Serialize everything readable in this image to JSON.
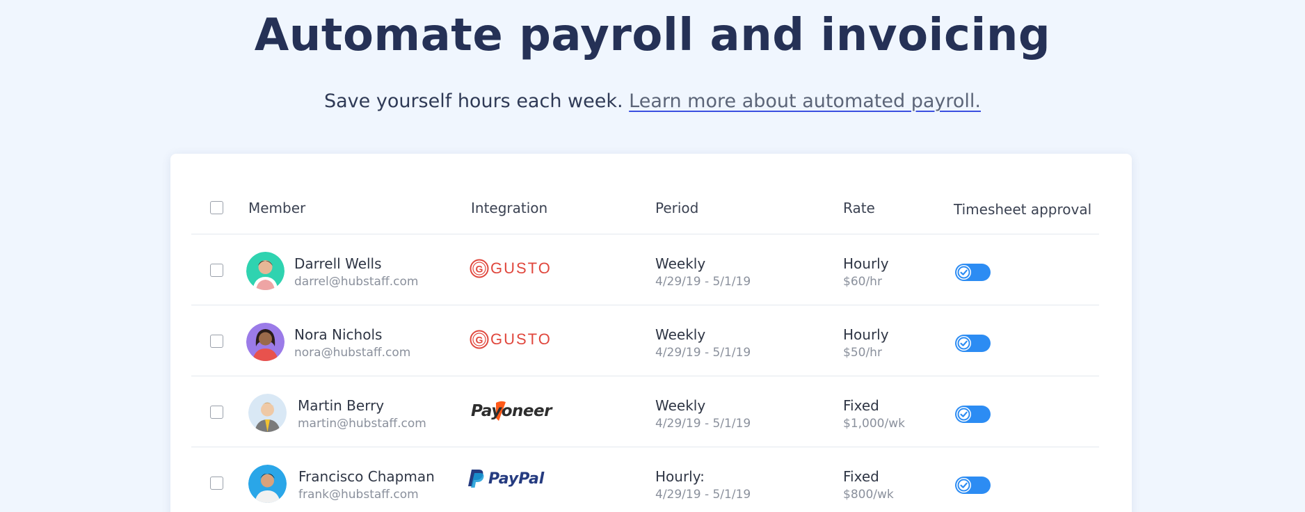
{
  "hero": {
    "title": "Automate payroll and invoicing",
    "subtitle": "Save yourself hours each week.",
    "link": "Learn more about automated payroll."
  },
  "table": {
    "headers": {
      "member": "Member",
      "integration": "Integration",
      "period": "Period",
      "rate": "Rate",
      "timesheet": "Timesheet approval"
    },
    "rows": [
      {
        "name": "Darrell Wells",
        "email": "darrel@hubstaff.com",
        "integration": "GUSTO",
        "period": "Weekly",
        "period_range": "4/29/19 - 5/1/19",
        "rate": "Hourly",
        "rate_value": "$60/hr",
        "avatar_color": "#2fd3b0",
        "timesheet_approved": true
      },
      {
        "name": "Nora Nichols",
        "email": "nora@hubstaff.com",
        "integration": "GUSTO",
        "period": "Weekly",
        "period_range": "4/29/19 - 5/1/19",
        "rate": "Hourly",
        "rate_value": "$50/hr",
        "avatar_color": "#9b7be8",
        "timesheet_approved": true
      },
      {
        "name": "Martin Berry",
        "email": "martin@hubstaff.com",
        "integration": "Payoneer",
        "period": "Weekly",
        "period_range": "4/29/19 - 5/1/19",
        "rate": "Fixed",
        "rate_value": "$1,000/wk",
        "avatar_color": "#d9e8f5",
        "timesheet_approved": true
      },
      {
        "name": "Francisco Chapman",
        "email": "frank@hubstaff.com",
        "integration": "PayPal",
        "period": "Hourly:",
        "period_range": "4/29/19 - 5/1/19",
        "rate": "Fixed",
        "rate_value": "$800/wk",
        "avatar_color": "#2aa6e8",
        "timesheet_approved": true
      }
    ]
  },
  "colors": {
    "background": "#f0f6fe",
    "toggle_on": "#2c8cf3",
    "gusto": "#e0473d",
    "paypal_dark": "#253b80",
    "paypal_light": "#179bd7",
    "payoneer_orange": "#ff4800"
  }
}
